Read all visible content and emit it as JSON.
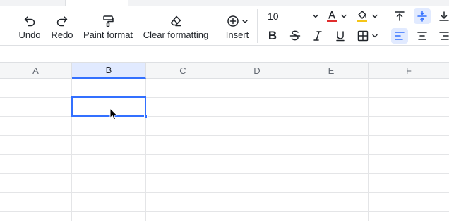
{
  "toolbar": {
    "undo_label": "Undo",
    "redo_label": "Redo",
    "paint_format_label": "Paint format",
    "clear_formatting_label": "Clear formatting",
    "insert_label": "Insert",
    "font_size": "10",
    "colors": {
      "text_color": "#e02d2d",
      "fill_color": "#f5c518",
      "accent": "#3370ff"
    }
  },
  "columns": [
    "A",
    "B",
    "C",
    "D",
    "E",
    "F"
  ],
  "selection": {
    "column": "B"
  }
}
